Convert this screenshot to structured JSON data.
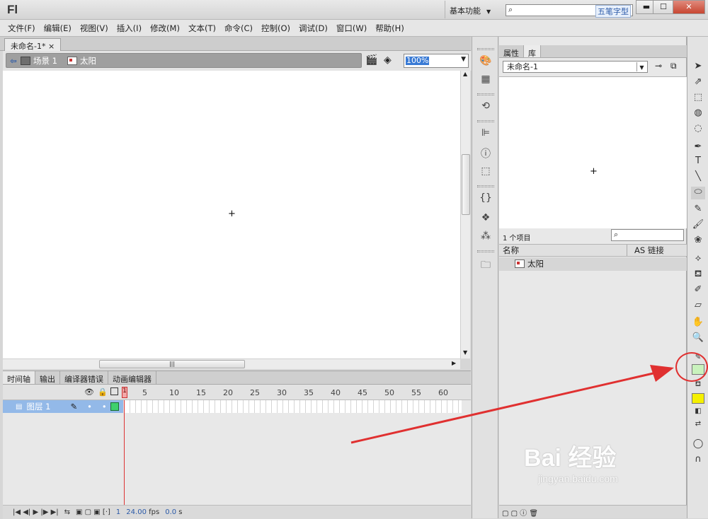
{
  "app": {
    "logo": "Fl",
    "workspace": "基本功能",
    "search_stamp": "五笔字型",
    "win": {
      "min": "▬",
      "max": "☐",
      "close": "✕"
    }
  },
  "menu": [
    "文件(F)",
    "编辑(E)",
    "视图(V)",
    "插入(I)",
    "修改(M)",
    "文本(T)",
    "命令(C)",
    "控制(O)",
    "调试(D)",
    "窗口(W)",
    "帮助(H)"
  ],
  "doc_tab": "未命名-1*  ×",
  "breadcrumb": {
    "scene": "场景 1",
    "symbol": "太阳"
  },
  "zoom": "100%",
  "timeline": {
    "tabs": [
      "时间轴",
      "输出",
      "编译器错误",
      "动画编辑器"
    ],
    "frame_numbers": [
      "5",
      "10",
      "15",
      "20",
      "25",
      "30",
      "35",
      "40",
      "45",
      "50",
      "55",
      "60"
    ],
    "playhead": "1",
    "layer": "图层 1",
    "footer": {
      "frame": "1",
      "fps": "24.00",
      "fps_unit": "fps",
      "time": "0.0",
      "time_unit": "s"
    }
  },
  "library": {
    "tabs": [
      "属性",
      "库"
    ],
    "doc": "未命名-1",
    "count": "1 个项目",
    "col_name": "名称",
    "col_as": "AS 链接",
    "items": [
      "太阳"
    ]
  },
  "tools": {
    "fill_color": "#c9f2bd",
    "stroke_color": "#f5f000",
    "text_tool": "T"
  },
  "watermark": {
    "brand": "Bai 经验",
    "url": "jingyan.baidu.com"
  },
  "annotation": {
    "circle_color": "#e03030",
    "arrow_color": "#e03030"
  }
}
